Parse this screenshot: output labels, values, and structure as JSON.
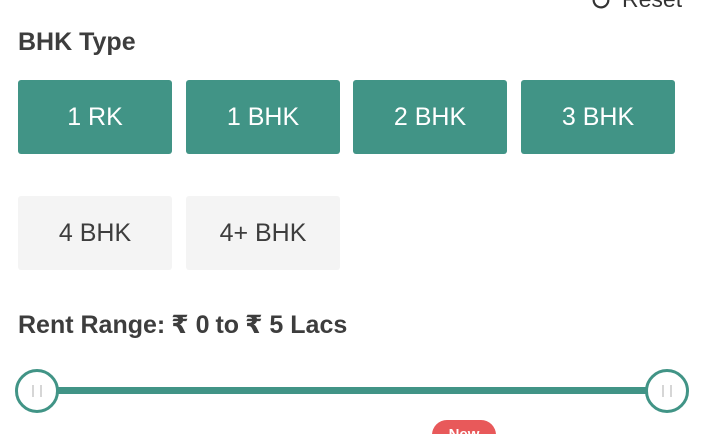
{
  "header": {
    "reset_label": "Reset",
    "reset_icon": "refresh-icon"
  },
  "bhk": {
    "title": "BHK Type",
    "options": [
      {
        "label": "1 RK",
        "selected": true
      },
      {
        "label": "1 BHK",
        "selected": true
      },
      {
        "label": "2 BHK",
        "selected": true
      },
      {
        "label": "3 BHK",
        "selected": true
      },
      {
        "label": "4 BHK",
        "selected": false
      },
      {
        "label": "4+ BHK",
        "selected": false
      }
    ]
  },
  "rent": {
    "title_prefix": "Rent Range:",
    "min_text": "₹ 0",
    "joiner": "to",
    "max_text": "₹ 5 Lacs",
    "min_value_fraction": 0,
    "max_value_fraction": 1
  },
  "badge": {
    "label": "New"
  },
  "colors": {
    "accent": "#419486",
    "unselected_bg": "#f4f4f4",
    "badge": "#e8595a",
    "text": "#3d3d3d"
  }
}
